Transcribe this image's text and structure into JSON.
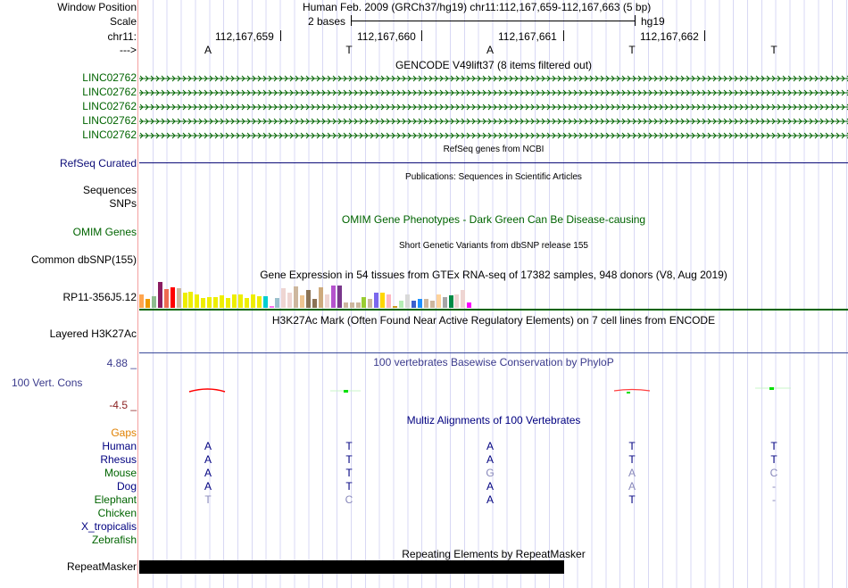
{
  "header": {
    "window_position_label": "Window Position",
    "window_position_text": "Human Feb. 2009 (GRCh37/hg19)   chr11:112,167,659-112,167,663 (5 bp)",
    "scale_label": "Scale",
    "scale_text": "2 bases",
    "scale_assembly": "hg19",
    "chrom_label": "chr11:",
    "positions": [
      "112,167,659",
      "112,167,660",
      "112,167,661",
      "112,167,662"
    ],
    "strand_label": "--->",
    "bases": [
      "A",
      "T",
      "A",
      "T",
      "T"
    ]
  },
  "tracks": {
    "gencode": {
      "title": "GENCODE V49lift37 (8 items filtered out)",
      "items": [
        "LINC02762",
        "LINC02762",
        "LINC02762",
        "LINC02762",
        "LINC02762"
      ],
      "color": "#006400"
    },
    "refseq": {
      "title": "RefSeq genes from NCBI",
      "label": "RefSeq Curated",
      "color": "#0c0c78"
    },
    "publications": {
      "title": "Publications: Sequences in Scientific Articles",
      "label": "Sequences"
    },
    "snps": {
      "label": "SNPs"
    },
    "omim": {
      "title": "OMIM Gene Phenotypes - Dark Green Can Be Disease-causing",
      "label": "OMIM Genes"
    },
    "dbsnp": {
      "title": "Short Genetic Variants from dbSNP release 155",
      "label": "Common dbSNP(155)"
    },
    "gtex": {
      "title": "Gene Expression in 54 tissues from GTEx RNA-seq of 17382 samples, 948 donors (V8, Aug 2019)",
      "label": "RP11-356J5.12",
      "bars": [
        {
          "c": "#FFA54F",
          "v": 0.53
        },
        {
          "c": "#EE9A00",
          "v": 0.33
        },
        {
          "c": "#8FBC8F",
          "v": 0.46
        },
        {
          "c": "#8B1C62",
          "v": 1.0
        },
        {
          "c": "#EE6A50",
          "v": 0.73
        },
        {
          "c": "#FF0000",
          "v": 0.8
        },
        {
          "c": "#CDB79E",
          "v": 0.76
        },
        {
          "c": "#EEEE00",
          "v": 0.6
        },
        {
          "c": "#EEEE00",
          "v": 0.63
        },
        {
          "c": "#EEEE00",
          "v": 0.53
        },
        {
          "c": "#EEEE00",
          "v": 0.39
        },
        {
          "c": "#EEEE00",
          "v": 0.43
        },
        {
          "c": "#EEEE00",
          "v": 0.43
        },
        {
          "c": "#EEEE00",
          "v": 0.49
        },
        {
          "c": "#EEEE00",
          "v": 0.39
        },
        {
          "c": "#EEEE00",
          "v": 0.53
        },
        {
          "c": "#EEEE00",
          "v": 0.53
        },
        {
          "c": "#EEEE00",
          "v": 0.39
        },
        {
          "c": "#EEEE00",
          "v": 0.53
        },
        {
          "c": "#EEEE00",
          "v": 0.46
        },
        {
          "c": "#00CED1",
          "v": 0.46
        },
        {
          "c": "#FF6EF0",
          "v": 0.06
        },
        {
          "c": "#9AC0CD",
          "v": 0.39
        },
        {
          "c": "#EED5D2",
          "v": 0.76
        },
        {
          "c": "#EED5D2",
          "v": 0.6
        },
        {
          "c": "#CDB79E",
          "v": 0.83
        },
        {
          "c": "#EEC591",
          "v": 0.49
        },
        {
          "c": "#8B7355",
          "v": 0.7
        },
        {
          "c": "#8B7355",
          "v": 0.33
        },
        {
          "c": "#CDAA7D",
          "v": 0.8
        },
        {
          "c": "#EED5D2",
          "v": 0.53
        },
        {
          "c": "#B452CD",
          "v": 0.87
        },
        {
          "c": "#7A378B",
          "v": 0.87
        },
        {
          "c": "#CDB79E",
          "v": 0.22
        },
        {
          "c": "#CDB79E",
          "v": 0.22
        },
        {
          "c": "#CDB79E",
          "v": 0.22
        },
        {
          "c": "#9ACD32",
          "v": 0.43
        },
        {
          "c": "#CDB79E",
          "v": 0.36
        },
        {
          "c": "#7B68EE",
          "v": 0.6
        },
        {
          "c": "#FFD700",
          "v": 0.6
        },
        {
          "c": "#FFB6C1",
          "v": 0.53
        },
        {
          "c": "#CD9B1D",
          "v": 0.06
        },
        {
          "c": "#B4EEB4",
          "v": 0.26
        },
        {
          "c": "#D9D9D9",
          "v": 0.53
        },
        {
          "c": "#3A5FCD",
          "v": 0.26
        },
        {
          "c": "#1E90FF",
          "v": 0.33
        },
        {
          "c": "#CDB79E",
          "v": 0.36
        },
        {
          "c": "#CDB79E",
          "v": 0.26
        },
        {
          "c": "#FFD39B",
          "v": 0.53
        },
        {
          "c": "#A6A6A6",
          "v": 0.43
        },
        {
          "c": "#008B45",
          "v": 0.49
        },
        {
          "c": "#EED5D2",
          "v": 0.53
        },
        {
          "c": "#EED5D2",
          "v": 0.7
        },
        {
          "c": "#FF00FF",
          "v": 0.19
        }
      ]
    },
    "h3k27ac": {
      "title": "H3K27Ac Mark (Often Found Near Active Regulatory Elements) on 7 cell lines from ENCODE",
      "label": "Layered H3K27Ac"
    },
    "phylop": {
      "title": "100 vertebrates Basewise Conservation by PhyloP",
      "label": "100 Vert. Cons",
      "max": "4.88 _",
      "min": "-4.5 _"
    },
    "multiz": {
      "title": "Multiz Alignments of 100 Vertebrates",
      "gaps_label": "Gaps",
      "species": [
        {
          "name": "Human",
          "color": "#000080",
          "bases": [
            "A",
            "T",
            "A",
            "T",
            "T"
          ]
        },
        {
          "name": "Rhesus",
          "color": "#000080",
          "bases": [
            "A",
            "T",
            "A",
            "T",
            "T"
          ]
        },
        {
          "name": "Mouse",
          "color": "#006400",
          "bases": [
            "A",
            "T",
            "G",
            "A",
            "C"
          ]
        },
        {
          "name": "Dog",
          "color": "#000080",
          "bases": [
            "A",
            "T",
            "A",
            "A",
            "-"
          ]
        },
        {
          "name": "Elephant",
          "color": "#006400",
          "bases": [
            "T",
            "C",
            "A",
            "T",
            "-"
          ]
        },
        {
          "name": "Chicken",
          "color": "#006400",
          "bases": []
        },
        {
          "name": "X_tropicalis",
          "color": "#000080",
          "bases": []
        },
        {
          "name": "Zebrafish",
          "color": "#006400",
          "bases": []
        }
      ]
    },
    "repeatmasker": {
      "title": "Repeating Elements by RepeatMasker",
      "label": "RepeatMasker"
    }
  }
}
